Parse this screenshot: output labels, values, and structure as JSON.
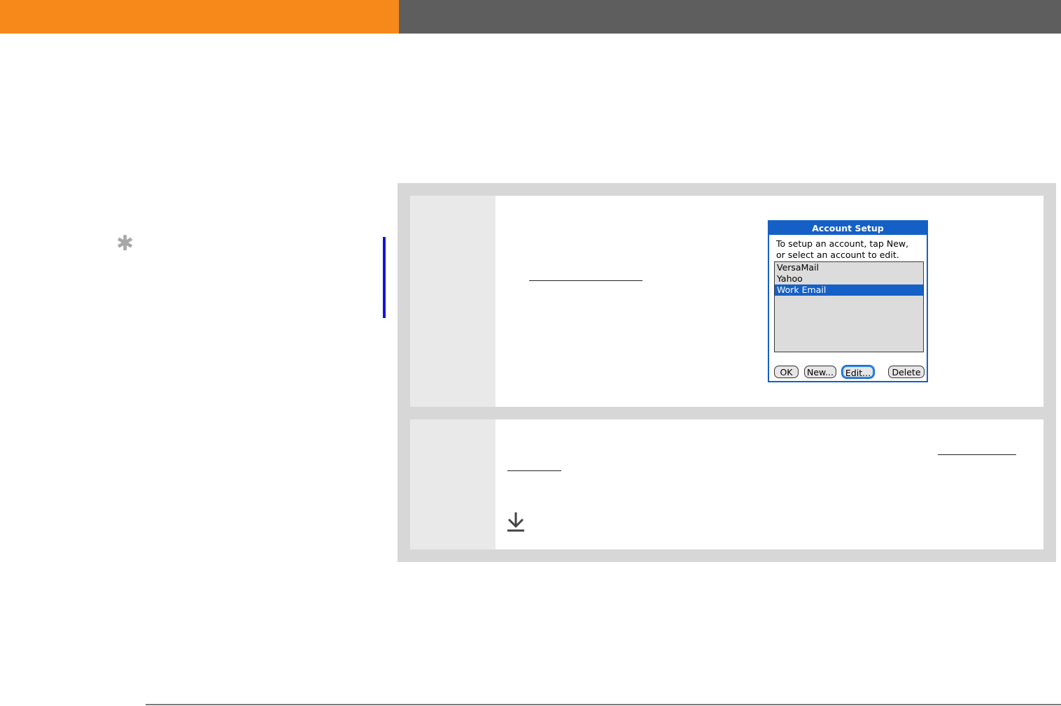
{
  "header": {
    "accent_color": "#f7891a",
    "bar_color": "#5e5e5e"
  },
  "tip": {
    "icon": "asterisk-icon"
  },
  "dialog": {
    "title": "Account Setup",
    "instruction_line1": "To setup an account, tap New,",
    "instruction_line2": "or select an account to edit.",
    "accounts": [
      "VersaMail",
      "Yahoo",
      "Work Email"
    ],
    "selected_index": 2,
    "buttons": {
      "ok": "OK",
      "new": "New...",
      "edit": "Edit...",
      "delete": "Delete"
    }
  },
  "step2": {
    "icon": "download-arrow-icon"
  }
}
